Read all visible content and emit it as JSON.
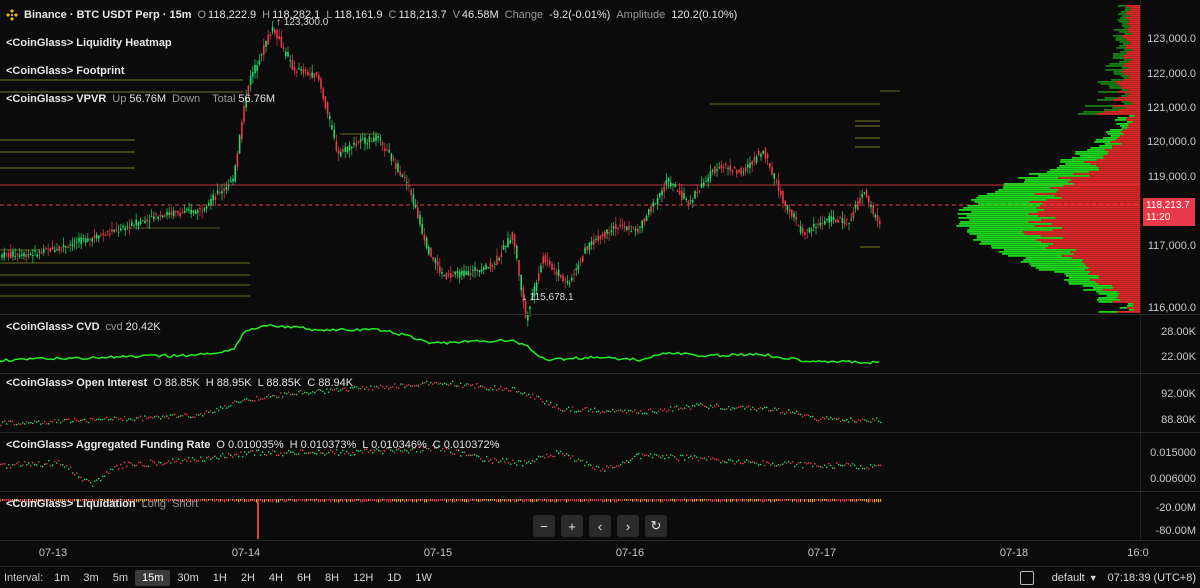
{
  "header": {
    "symbol": "Binance · BTC USDT Perp · 15m",
    "ohlc": [
      {
        "k": "O",
        "v": "118,222.9"
      },
      {
        "k": "H",
        "v": "118,282.1"
      },
      {
        "k": "L",
        "v": "118,161.9"
      },
      {
        "k": "C",
        "v": "118,213.7"
      },
      {
        "k": "V",
        "v": "46.58M"
      }
    ],
    "change_label": "Change",
    "change_value": "-9.2(-0.01%)",
    "amplitude_label": "Amplitude",
    "amplitude_value": "120.2(0.10%)"
  },
  "indicators": {
    "heatmap": "<CoinGlass> Liquidity Heatmap",
    "footprint": "<CoinGlass> Footprint",
    "vpvr": {
      "title": "<CoinGlass> VPVR",
      "up_label": "Up",
      "up_value": "56.76M",
      "down_label": "Down",
      "total_label": "Total",
      "total_value": "56.76M"
    },
    "cvd": {
      "title": "<CoinGlass> CVD",
      "label": "cvd",
      "value": "20.42K"
    },
    "oi": {
      "title": "<CoinGlass> Open Interest",
      "o": "O 88.85K",
      "h": "H 88.95K",
      "l": "L 88.85K",
      "c": "C 88.94K"
    },
    "funding": {
      "title": "<CoinGlass> Aggregated Funding Rate",
      "o": "O 0.010035%",
      "h": "H 0.010373%",
      "l": "L 0.010346%",
      "c": "C 0.010372%"
    },
    "liquidation": {
      "title": "<CoinGlass> Liquidation",
      "long": "Long",
      "short": "Short"
    }
  },
  "price_axis": [
    "123,000.0",
    "122,000.0",
    "121,000.0",
    "120,000.0",
    "119,000.0",
    "117,000.0",
    "116,000.0"
  ],
  "current_price": {
    "price": "118,213.7",
    "time": "11:20"
  },
  "annotations": {
    "high": "123,300.0",
    "low": "115,678.1"
  },
  "cvd_axis": [
    "28.00K",
    "22.00K"
  ],
  "oi_axis": [
    "92.00K",
    "88.80K"
  ],
  "funding_axis": [
    "0.015000",
    "0.006000"
  ],
  "liq_axis": [
    "-20.00M",
    "-80.00M"
  ],
  "time_axis": [
    "07-13",
    "07-14",
    "07-15",
    "07-16",
    "07-17",
    "07-18",
    "16:0"
  ],
  "nav": {
    "zoom_out": "−",
    "zoom_in": "+",
    "prev": "‹",
    "next": "›",
    "reset": "↻"
  },
  "bottom": {
    "interval_label": "Interval:",
    "intervals": [
      "1m",
      "3m",
      "5m",
      "15m",
      "30m",
      "1H",
      "2H",
      "4H",
      "6H",
      "8H",
      "12H",
      "1D",
      "1W"
    ],
    "active_interval": "15m",
    "layout": "default",
    "clock": "07:18:39 (UTC+8)"
  },
  "colors": {
    "up": "#26d96b",
    "down": "#e8394a",
    "volume_up": "#1fe01f",
    "volume_down": "#e82a2a",
    "cvd": "#22ee22",
    "level": "#c9c83a"
  }
}
